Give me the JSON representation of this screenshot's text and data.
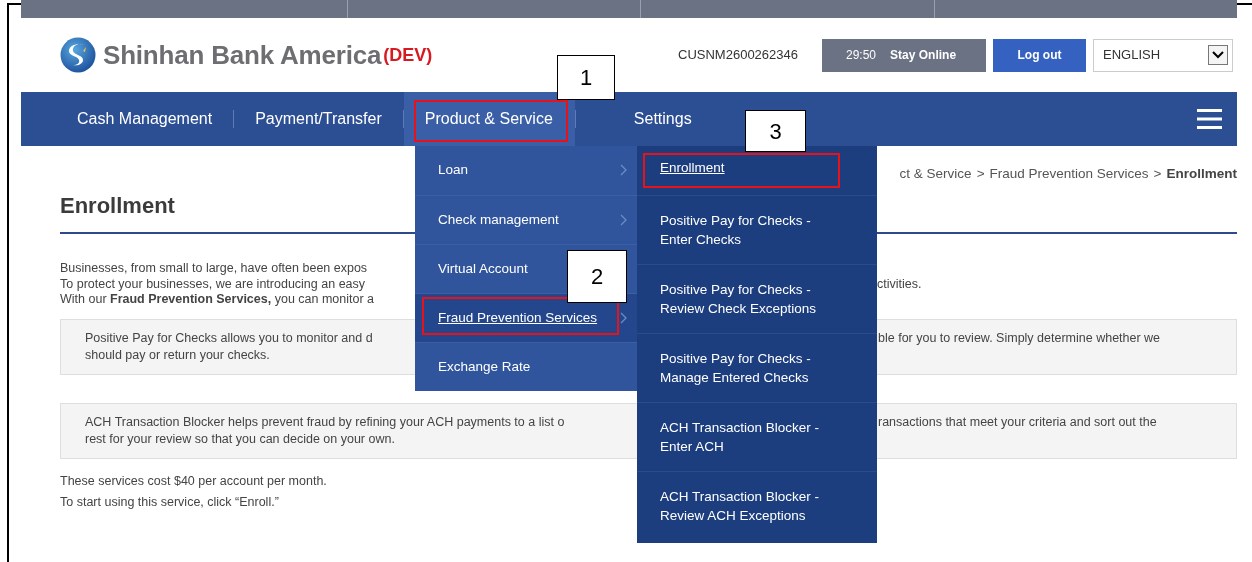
{
  "header": {
    "logo": {
      "name": "Shinhan Bank America",
      "suffix": "(DEV)"
    },
    "customer_id": "CUSNM2600262346",
    "session": {
      "timer": "29:50",
      "label": "Stay Online"
    },
    "logout": "Log out",
    "language": {
      "value": "ENGLISH"
    }
  },
  "nav": {
    "items": [
      {
        "label": "Cash Management",
        "selected": false,
        "highlighted": false
      },
      {
        "label": "Payment/Transfer",
        "selected": false,
        "highlighted": false
      },
      {
        "label": "Product & Service",
        "selected": true,
        "highlighted": true
      },
      {
        "label": "Settings",
        "selected": false,
        "highlighted": false
      }
    ]
  },
  "menu": {
    "items": [
      {
        "label": "Loan",
        "has_submenu": true,
        "selected": false,
        "highlighted": false
      },
      {
        "label": "Check management",
        "has_submenu": true,
        "selected": false,
        "highlighted": false
      },
      {
        "label": "Virtual Account",
        "has_submenu": false,
        "selected": false,
        "highlighted": false
      },
      {
        "label": "Fraud Prevention Services",
        "has_submenu": true,
        "selected": true,
        "highlighted": true
      },
      {
        "label": "Exchange Rate",
        "has_submenu": false,
        "selected": false,
        "highlighted": false
      }
    ]
  },
  "submenu": {
    "items": [
      {
        "label": "Enrollment",
        "selected": true,
        "highlighted": true
      },
      {
        "label": "Positive Pay for Checks - Enter Checks",
        "selected": false,
        "highlighted": false
      },
      {
        "label": "Positive Pay for Checks - Review Check Exceptions",
        "selected": false,
        "highlighted": false
      },
      {
        "label": "Positive Pay for Checks - Manage Entered Checks",
        "selected": false,
        "highlighted": false
      },
      {
        "label": "ACH Transaction Blocker - Enter ACH",
        "selected": false,
        "highlighted": false
      },
      {
        "label": "ACH Transaction Blocker - Review ACH Exceptions",
        "selected": false,
        "highlighted": false
      }
    ]
  },
  "breadcrumb": [
    {
      "label": "ct & Service",
      "current": false,
      "separator": ">"
    },
    {
      "label": "Fraud Prevention Services",
      "current": false,
      "separator": ">"
    },
    {
      "label": "Enrollment",
      "current": true
    }
  ],
  "page_title": "Enrollment",
  "intro": [
    {
      "left": "Businesses, from small to large,  have often been expos"
    },
    {
      "left": "To protect your businesses, we are introducing an easy",
      "right": "ctivities."
    },
    {
      "left": "With our **Fraud Prevention Services,** you can monitor a"
    }
  ],
  "info_boxes": [
    {
      "lines": [
        {
          "left": "Positive Pay for Checks allows you to monitor and d",
          "right": "ble for you to review. Simply determine whether we"
        },
        {
          "left": "should pay or return your checks."
        }
      ]
    },
    {
      "lines": [
        {
          "left": "ACH Transaction Blocker helps prevent fraud by refining your ACH payments to a list o",
          "right": "ransactions that meet your criteria and sort out the"
        },
        {
          "left": "rest for your review so that you can decide on your own."
        }
      ]
    }
  ],
  "notes": [
    "These services cost $40 per account per month.",
    "To start using this service, click “Enroll.”"
  ],
  "callouts": [
    {
      "label": "1"
    },
    {
      "label": "2"
    },
    {
      "label": "3"
    }
  ]
}
